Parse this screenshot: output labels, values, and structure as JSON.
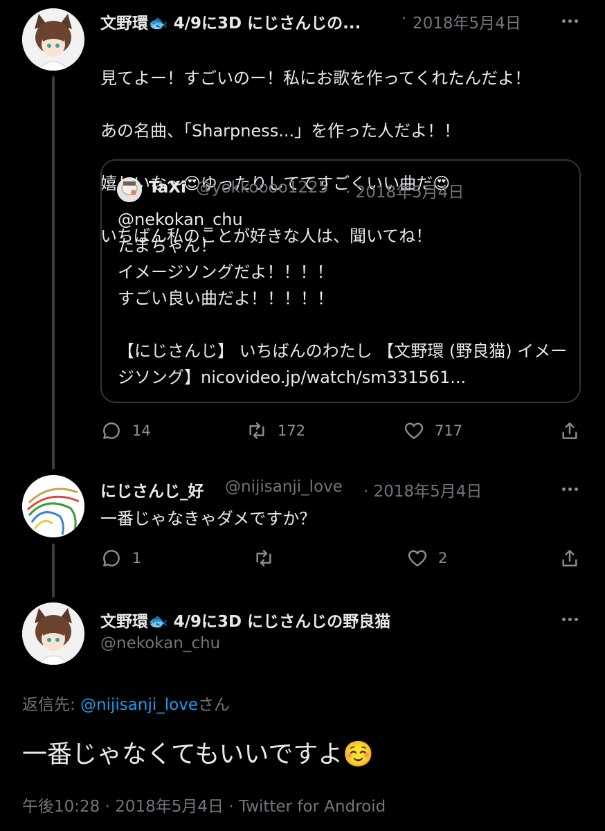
{
  "tweet1": {
    "display_name": "文野環🐟 4/9に3D にじさんじの...",
    "separator": "·",
    "date": "2018年5月4日",
    "lines": [
      "見てよー！すごいのー！私にお歌を作ってくれたんだよ！",
      "あの名曲、「Sharpness...」を作った人だよ！！",
      "嬉しいな〜😍ゆったりしててすごくいい曲だ😍",
      "いちばん私のことが好きな人は、聞いてね！"
    ],
    "quote": {
      "name": "TaXi",
      "handle": "@yokkoooo1225",
      "date": "· 2018年5月4日",
      "text": "@nekokan_chu\nたまちゃん！\nイメージソングだよ！！！！\nすごい良い曲だよ！！！！！\n\n【にじさんじ】 いちばんのわたし 【文野環 (野良猫) イメージソング】nicovideo.jp/watch/sm331561..."
    },
    "replies": "14",
    "retweets": "172",
    "likes": "717"
  },
  "tweet2": {
    "display_name": "にじさんじ_好",
    "handle": "@nijisanji_love",
    "date": "· 2018年5月4日",
    "text": "一番じゃなきゃダメですか？",
    "replies": "1",
    "retweets": "",
    "likes": "2"
  },
  "tweet3": {
    "display_name": "文野環🐟 4/9に3D にじさんじの野良猫",
    "handle": "@nekokan_chu",
    "reply_prefix": "返信先: ",
    "reply_to": "@nijisanji_love",
    "reply_suffix": "さん",
    "text": "一番じゃなくてもいいですよ☺️",
    "meta": "午後10:28 · 2018年5月4日 · Twitter for Android"
  },
  "colors": {
    "background": "#000000",
    "text": "#e7e9ea",
    "muted": "#71767b",
    "link": "#1d9bf0",
    "border": "#333639"
  }
}
